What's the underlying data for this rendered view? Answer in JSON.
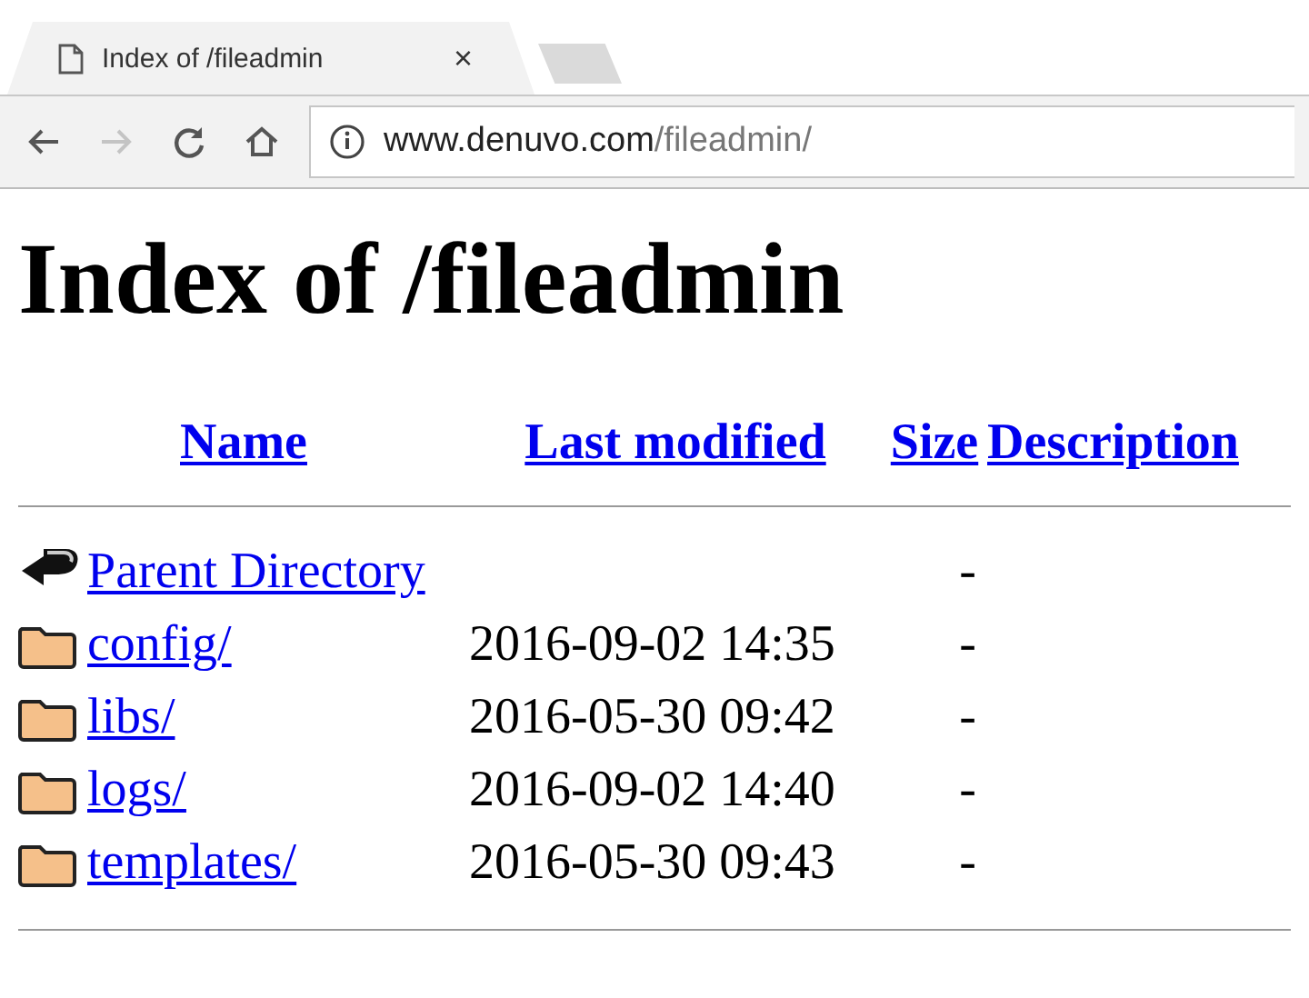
{
  "browser": {
    "tab": {
      "title": "Index of /fileadmin",
      "close": "×"
    },
    "back_disabled": false,
    "forward_disabled": true,
    "url": {
      "host": "www.denuvo.com",
      "path": "/fileadmin/"
    }
  },
  "heading": "Index of /fileadmin",
  "table": {
    "columns": [
      "Name",
      "Last modified",
      "Size",
      "Description"
    ],
    "rows": [
      {
        "kind": "parent",
        "name": "Parent Directory",
        "modified": "",
        "size": "-"
      },
      {
        "kind": "folder",
        "name": "config/",
        "modified": "2016-09-02 14:35",
        "size": "-"
      },
      {
        "kind": "folder",
        "name": "libs/",
        "modified": "2016-05-30 09:42",
        "size": "-"
      },
      {
        "kind": "folder",
        "name": "logs/",
        "modified": "2016-09-02 14:40",
        "size": "-"
      },
      {
        "kind": "folder",
        "name": "templates/",
        "modified": "2016-05-30 09:43",
        "size": "-"
      }
    ]
  }
}
